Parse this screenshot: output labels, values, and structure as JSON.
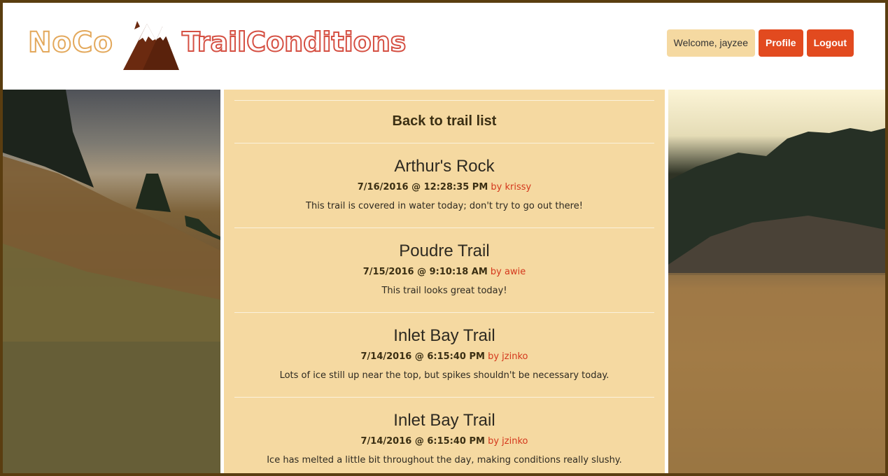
{
  "header": {
    "logo_left": "NoCo",
    "logo_right": "TrailConditions",
    "welcome": "Welcome, jayzee",
    "profile_label": "Profile",
    "logout_label": "Logout"
  },
  "main": {
    "back_label": "Back to trail list",
    "reports": [
      {
        "trail": "Arthur's Rock",
        "date": "7/16/2016 @ 12:28:35 PM",
        "by": "by krissy",
        "message": "This trail is covered in water today; don't try to go out there!"
      },
      {
        "trail": "Poudre Trail",
        "date": "7/15/2016 @ 9:10:18 AM",
        "by": "by awie",
        "message": "This trail looks great today!"
      },
      {
        "trail": "Inlet Bay Trail",
        "date": "7/14/2016 @ 6:15:40 PM",
        "by": "by jzinko",
        "message": "Lots of ice still up near the top, but spikes shouldn't be necessary today."
      },
      {
        "trail": "Inlet Bay Trail",
        "date": "7/14/2016 @ 6:15:40 PM",
        "by": "by jzinko",
        "message": "Ice has melted a little bit throughout the day, making conditions really slushy."
      }
    ]
  },
  "colors": {
    "accent": "#e24a1f",
    "panel": "#f5d9a1",
    "frame": "#5a3d10",
    "logo_noco": "#e3a85b",
    "logo_trail": "#d55043"
  }
}
